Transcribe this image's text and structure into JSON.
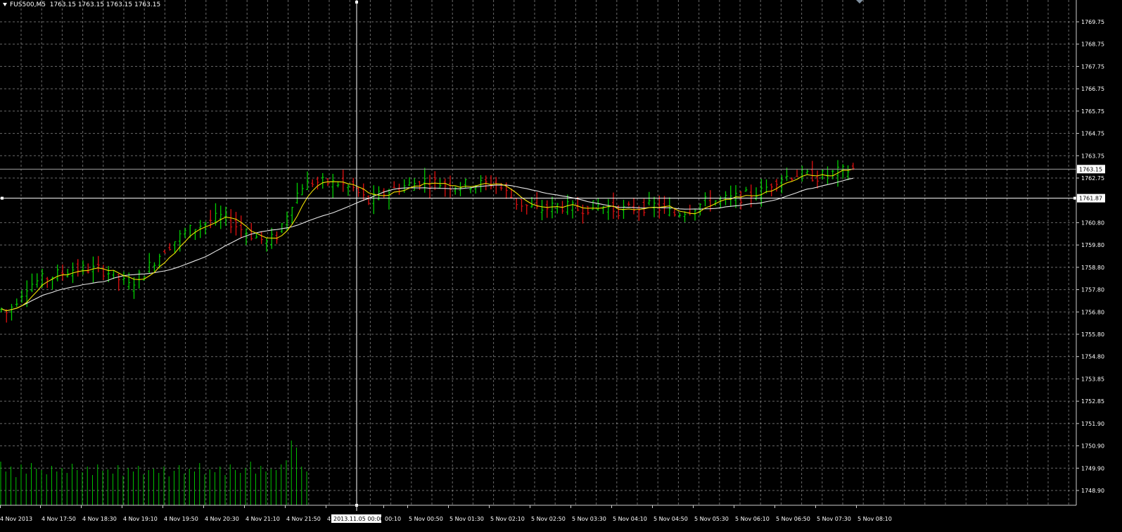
{
  "header": {
    "symbol": "FUS500,M5",
    "ohlc": "1763.15 1763.15 1763.15 1763.15"
  },
  "colors": {
    "background": "#000000",
    "grid": "#c0c0c0",
    "bull": "#00d000",
    "bear": "#e01010",
    "ma_fast": "#f0e000",
    "ma_slow": "#e8e8e8",
    "volume": "#00c000",
    "bid_line": "#a0a0a0",
    "crosshair": "#ffffff"
  },
  "price_axis": {
    "ticks": [
      "1769.75",
      "1768.75",
      "1767.75",
      "1766.75",
      "1765.75",
      "1764.75",
      "1763.75",
      "1762.75",
      "1760.80",
      "1759.80",
      "1758.80",
      "1757.80",
      "1756.80",
      "1755.80",
      "1754.80",
      "1753.85",
      "1752.85",
      "1751.90",
      "1750.90",
      "1749.90",
      "1748.90"
    ],
    "bid_label": "1763.15",
    "crosshair_label": "1761.87"
  },
  "time_axis": {
    "labels": [
      "4 Nov 2013",
      "4 Nov 17:50",
      "4 Nov 18:30",
      "4 Nov 19:10",
      "4 Nov 19:50",
      "4 Nov 20:30",
      "4 Nov 21:10",
      "4 Nov 21:50",
      "4",
      "00:10",
      "5 Nov 00:50",
      "5 Nov 01:30",
      "5 Nov 02:10",
      "5 Nov 02:50",
      "5 Nov 03:30",
      "5 Nov 04:10",
      "5 Nov 04:50",
      "5 Nov 05:30",
      "5 Nov 06:10",
      "5 Nov 06:50",
      "5 Nov 07:30",
      "5 Nov 08:10"
    ],
    "crosshair_label": "2013.11.05 00:00"
  },
  "chart_data": {
    "type": "ohlc",
    "timeframe": "M5",
    "bid": 1763.15,
    "crosshair_price": 1761.87,
    "ylim": [
      1748.9,
      1769.75
    ],
    "close_keypoints": [
      [
        0,
        1756.91
      ],
      [
        1,
        1756.76
      ],
      [
        5,
        1757.97
      ],
      [
        8,
        1758.27
      ],
      [
        14,
        1758.72
      ],
      [
        19,
        1758.72
      ],
      [
        21,
        1758.57
      ],
      [
        25,
        1757.97
      ],
      [
        28,
        1758.6
      ],
      [
        32,
        1759.62
      ],
      [
        36,
        1760.37
      ],
      [
        40,
        1760.82
      ],
      [
        43,
        1761.05
      ],
      [
        45,
        1760.82
      ],
      [
        48,
        1760.37
      ],
      [
        52,
        1759.92
      ],
      [
        54,
        1760.22
      ],
      [
        57,
        1761.7
      ],
      [
        59,
        1762.43
      ],
      [
        61,
        1762.58
      ],
      [
        66,
        1762.52
      ],
      [
        69,
        1762.28
      ],
      [
        72,
        1761.7
      ],
      [
        74,
        1761.99
      ],
      [
        77,
        1762.28
      ],
      [
        83,
        1762.64
      ],
      [
        88,
        1762.43
      ],
      [
        97,
        1762.52
      ],
      [
        101,
        1761.7
      ],
      [
        105,
        1761.35
      ],
      [
        109,
        1761.55
      ],
      [
        113,
        1761.4
      ],
      [
        117,
        1761.55
      ],
      [
        121,
        1761.35
      ],
      [
        128,
        1761.55
      ],
      [
        132,
        1761.17
      ],
      [
        135,
        1761.4
      ],
      [
        138,
        1761.7
      ],
      [
        143,
        1761.84
      ],
      [
        149,
        1762.14
      ],
      [
        152,
        1762.72
      ],
      [
        156,
        1762.93
      ],
      [
        160,
        1762.81
      ],
      [
        164,
        1763.02
      ],
      [
        167,
        1763.15
      ]
    ],
    "ma_periods": [
      5,
      21
    ],
    "volume": [
      62,
      48,
      55,
      40,
      58,
      45,
      60,
      52,
      50,
      44,
      56,
      48,
      53,
      46,
      59,
      50,
      47,
      55,
      43,
      58,
      49,
      51,
      45,
      57,
      42,
      53,
      48,
      56,
      44,
      50,
      52,
      46,
      55,
      41,
      49,
      57,
      45,
      52,
      48,
      60,
      44,
      51,
      47,
      55,
      43,
      58,
      50,
      46,
      53,
      62,
      45,
      56,
      48,
      52,
      50,
      58,
      64,
      92,
      82,
      55,
      48
    ]
  }
}
